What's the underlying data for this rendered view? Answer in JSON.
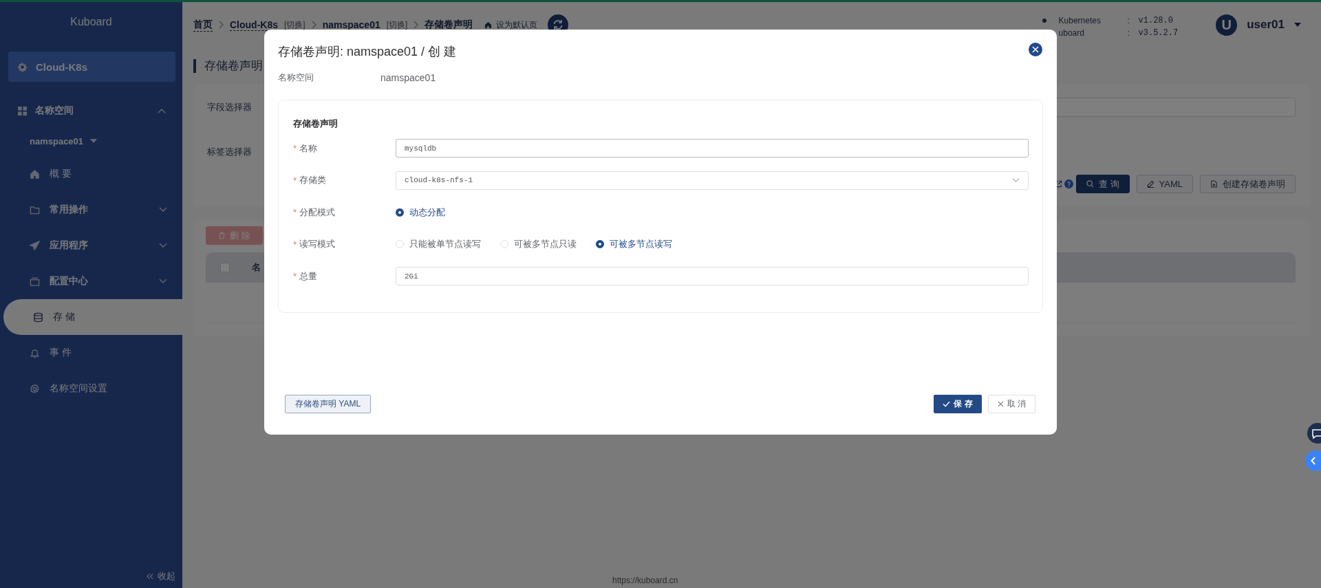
{
  "sidebar": {
    "title": "Kuboard",
    "cluster": "Cloud-K8s",
    "section": {
      "label": "名称空间",
      "expanded": true
    },
    "namespace": "namspace01",
    "items": [
      {
        "label": "概 要",
        "kind": "page",
        "selected": false
      },
      {
        "label": "常用操作",
        "kind": "group",
        "expanded": false,
        "selected": false
      },
      {
        "label": "应用程序",
        "kind": "group",
        "expanded": false,
        "selected": false
      },
      {
        "label": "配置中心",
        "kind": "group",
        "expanded": false,
        "selected": false
      },
      {
        "label": "存 储",
        "kind": "page",
        "selected": true
      },
      {
        "label": "事 件",
        "kind": "page",
        "selected": false
      },
      {
        "label": "名称空间设置",
        "kind": "page",
        "selected": false
      }
    ],
    "collapse": "收起"
  },
  "header": {
    "breadcrumb": [
      {
        "label": "首页",
        "kind": "link"
      },
      {
        "label": "Cloud-K8s",
        "kind": "link",
        "switch": "[切换]"
      },
      {
        "label": "namspace01",
        "kind": "plain",
        "switch": "[切换]"
      },
      {
        "label": "存储卷声明",
        "kind": "current"
      }
    ],
    "set_default": "设为默认页",
    "versions": [
      {
        "name": "Kubernetes",
        "sep": ":",
        "value": "v1.28.0"
      },
      {
        "name": "uboard",
        "sep": ":",
        "value": "v3.5.2.7"
      }
    ],
    "user": {
      "initial": "U",
      "name": "user01"
    }
  },
  "page": {
    "title": "存储卷声明",
    "filters": [
      {
        "label": "字段选择器"
      },
      {
        "label": "标签选择器"
      }
    ],
    "actions": [
      {
        "label": "查 询",
        "kind": "primary"
      },
      {
        "label": "YAML",
        "kind": "default"
      },
      {
        "label": "创建存储卷声明",
        "kind": "default"
      }
    ],
    "delete_button": {
      "label": "删 除",
      "disabled": true
    },
    "select_all": {
      "checked": false
    },
    "columns": [
      "名"
    ]
  },
  "modal": {
    "title": "存储卷声明: namspace01 / 创 建",
    "namespace_label": "名称空间",
    "namespace_value": "namspace01",
    "section_title": "存储卷声明",
    "fields": [
      {
        "kind": "text",
        "mark": "*",
        "label": "名称",
        "value": "mysqldb"
      },
      {
        "kind": "select",
        "mark": "*",
        "label": "存储类",
        "value": "cloud-k8s-nfs-1"
      },
      {
        "kind": "radio",
        "mark": "*",
        "label": "分配模式",
        "options": [
          {
            "label": "动态分配",
            "selected": true
          }
        ]
      },
      {
        "kind": "radio",
        "mark": "*",
        "label": "读写模式",
        "options": [
          {
            "label": "只能被单节点读写",
            "selected": false
          },
          {
            "label": "可被多节点只读",
            "selected": false
          },
          {
            "label": "可被多节点读写",
            "selected": true
          }
        ]
      },
      {
        "kind": "text",
        "mark": "*",
        "label": "总量",
        "value": "2Gi"
      }
    ],
    "yaml_button": "存储卷声明 YAML",
    "save": "保 存",
    "cancel": "取 消"
  },
  "footer": "https://kuboard.cn"
}
